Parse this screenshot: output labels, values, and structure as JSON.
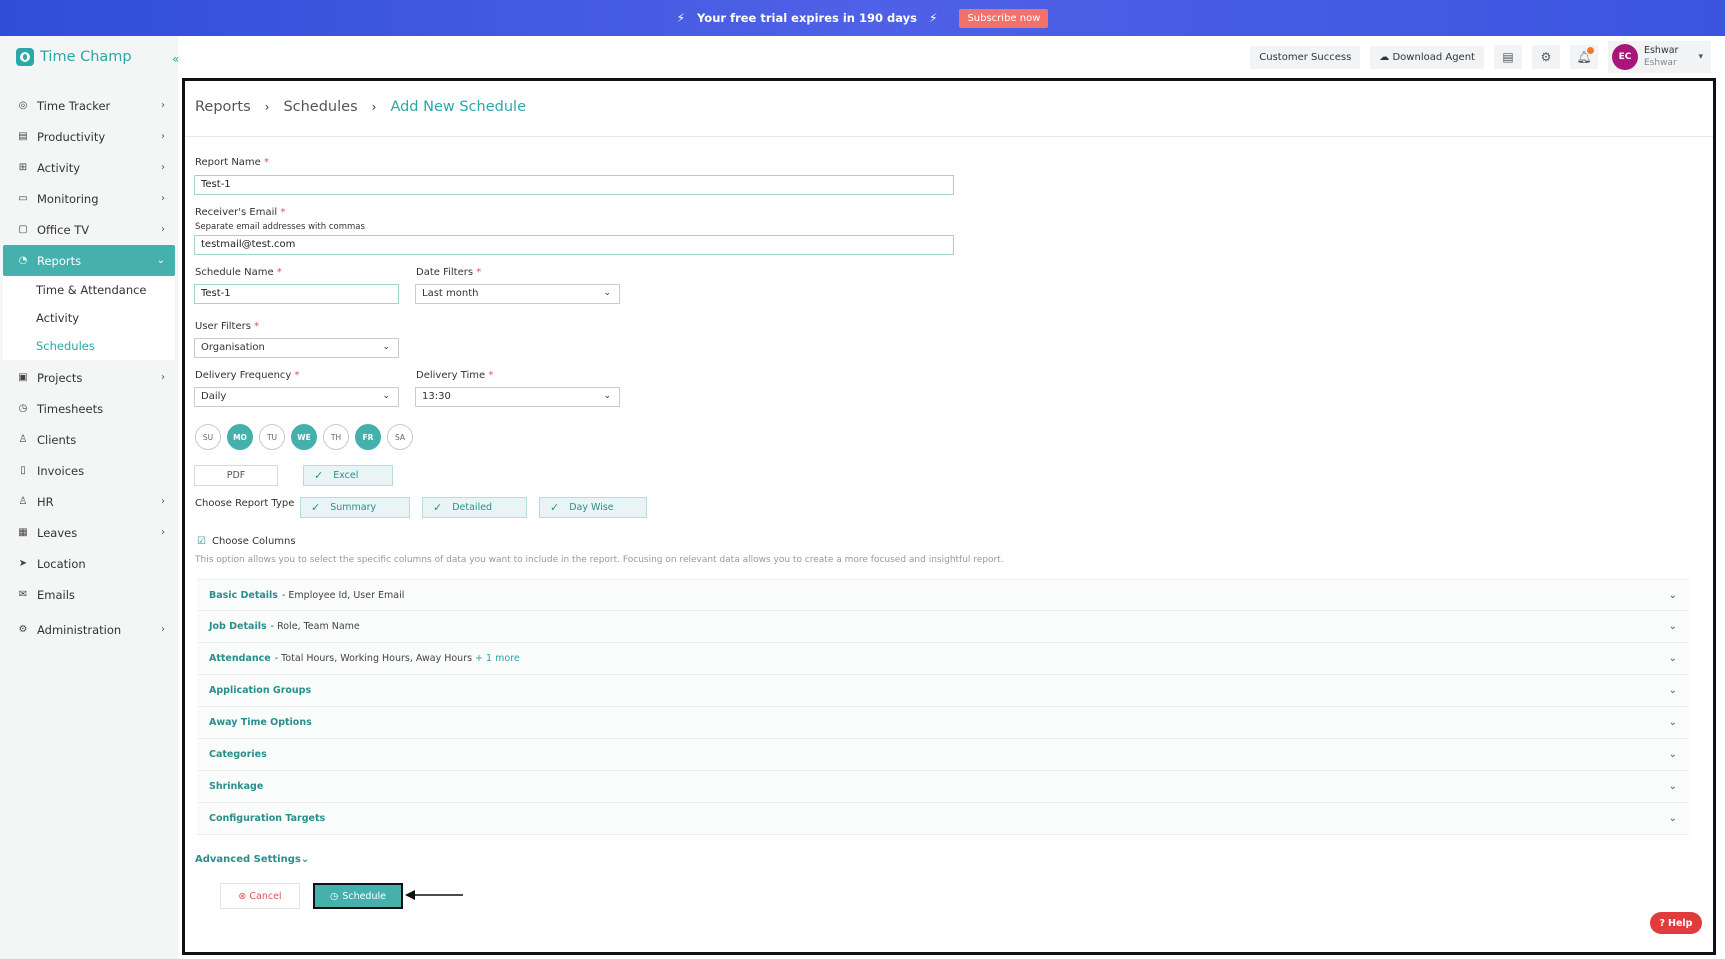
{
  "banner": {
    "message": "Your free trial expires in 190 days",
    "subscribe_label": "Subscribe now"
  },
  "app": {
    "name": "Time Champ",
    "collapse_glyph": "«"
  },
  "sidebar": {
    "items": [
      {
        "label": "Time Tracker",
        "icon": "stopwatch-icon"
      },
      {
        "label": "Productivity",
        "icon": "chart-icon"
      },
      {
        "label": "Activity",
        "icon": "activity-icon"
      },
      {
        "label": "Monitoring",
        "icon": "monitor-icon"
      },
      {
        "label": "Office TV",
        "icon": "tv-icon"
      },
      {
        "label": "Reports",
        "icon": "reports-icon"
      },
      {
        "label": "Projects",
        "icon": "briefcase-icon"
      },
      {
        "label": "Timesheets",
        "icon": "clock-icon"
      },
      {
        "label": "Clients",
        "icon": "person-icon"
      },
      {
        "label": "Invoices",
        "icon": "invoice-icon"
      },
      {
        "label": "HR",
        "icon": "person-icon"
      },
      {
        "label": "Leaves",
        "icon": "calendar-icon"
      },
      {
        "label": "Location",
        "icon": "location-icon"
      },
      {
        "label": "Emails",
        "icon": "mail-icon"
      },
      {
        "label": "Administration",
        "icon": "gear-icon"
      }
    ],
    "reports_sub": [
      {
        "label": "Time & Attendance"
      },
      {
        "label": "Activity"
      },
      {
        "label": "Schedules"
      }
    ]
  },
  "header": {
    "customer_success": "Customer Success",
    "download_agent": "Download Agent",
    "user": {
      "initials": "EC",
      "name": "Eshwar",
      "sub": "Eshwar"
    }
  },
  "breadcrumb": {
    "l1": "Reports",
    "l2": "Schedules",
    "l3": "Add New Schedule",
    "sep": "›"
  },
  "form": {
    "report_name": {
      "label": "Report Name",
      "value": "Test-1"
    },
    "receiver_email": {
      "label": "Receiver's Email",
      "hint": "Separate email addresses with commas",
      "value": "testmail@test.com"
    },
    "schedule_name": {
      "label": "Schedule Name",
      "value": "Test-1"
    },
    "date_filters": {
      "label": "Date Filters",
      "value": "Last month"
    },
    "user_filters": {
      "label": "User Filters",
      "value": "Organisation"
    },
    "delivery_frequency": {
      "label": "Delivery Frequency",
      "value": "Daily"
    },
    "delivery_time": {
      "label": "Delivery Time",
      "value": "13:30"
    },
    "required": "*",
    "days": [
      {
        "label": "SU",
        "selected": false
      },
      {
        "label": "MO",
        "selected": true
      },
      {
        "label": "TU",
        "selected": false
      },
      {
        "label": "WE",
        "selected": true
      },
      {
        "label": "TH",
        "selected": false
      },
      {
        "label": "FR",
        "selected": true
      },
      {
        "label": "SA",
        "selected": false
      }
    ],
    "formats": {
      "pdf": "PDF",
      "excel": "Excel"
    },
    "report_type": {
      "label": "Choose Report Type",
      "summary": "Summary",
      "detailed": "Detailed",
      "day_wise": "Day Wise"
    },
    "choose_columns": {
      "title": "Choose Columns",
      "description": "This option allows you to select the specific columns of data you want to include in the report. Focusing on relevant data allows you to create a more focused and insightful report."
    },
    "sections": [
      {
        "title": "Basic Details",
        "detail": "- Employee Id, User Email",
        "more": ""
      },
      {
        "title": "Job Details",
        "detail": "- Role, Team Name",
        "more": ""
      },
      {
        "title": "Attendance",
        "detail": "- Total Hours, Working Hours, Away Hours",
        "more": "+ 1 more"
      },
      {
        "title": "Application Groups",
        "detail": "",
        "more": ""
      },
      {
        "title": "Away Time Options",
        "detail": "",
        "more": ""
      },
      {
        "title": "Categories",
        "detail": "",
        "more": ""
      },
      {
        "title": "Shrinkage",
        "detail": "",
        "more": ""
      },
      {
        "title": "Configuration Targets",
        "detail": "",
        "more": ""
      }
    ],
    "advanced": "Advanced Settings",
    "cancel": "Cancel",
    "schedule": "Schedule"
  },
  "help": "Help",
  "colors": {
    "accent": "#46b0ad",
    "banner": "#3b55df",
    "subscribe": "#f2716a",
    "help": "#e23b3b",
    "avatar": "#a7177a"
  }
}
